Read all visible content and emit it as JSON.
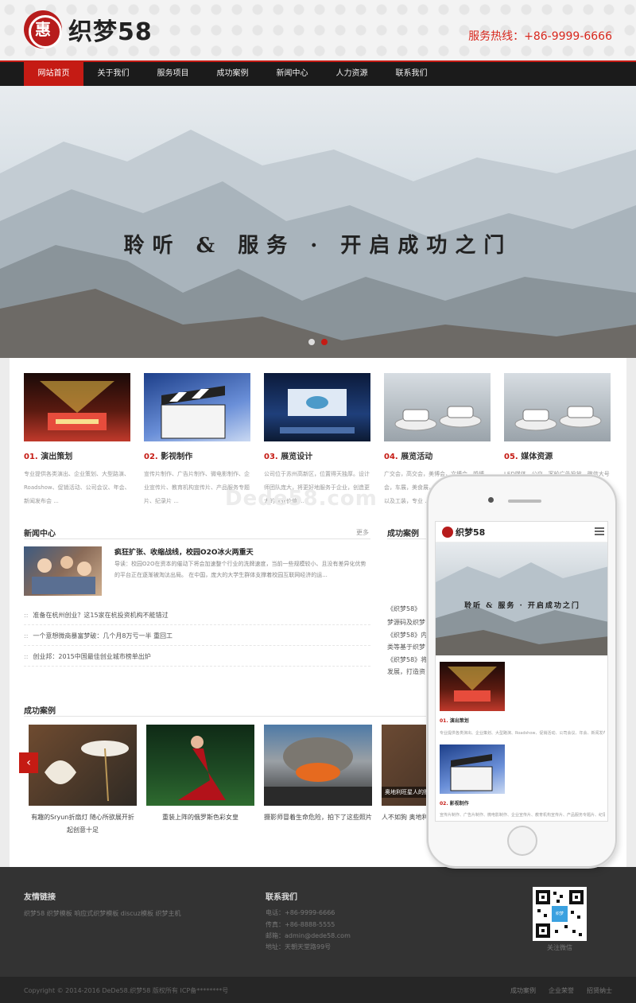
{
  "header": {
    "logo_badge": "惠",
    "logo_text": "织梦58",
    "hotline": "服务热线：+86-9999-6666"
  },
  "nav": {
    "items": [
      "网站首页",
      "关于我们",
      "服务项目",
      "成功案例",
      "新闻中心",
      "人力资源",
      "联系我们"
    ],
    "active": 0
  },
  "banner": {
    "slogan": "聆听 & 服务 · 开启成功之门",
    "slides": 2,
    "active_slide": 1
  },
  "services": [
    {
      "num": "01.",
      "title": "演出策划",
      "desc": "专业提供各类演出、企业策划、大型路演、Roadshow、促销活动、公司会议、年会、新闻发布会 ..."
    },
    {
      "num": "02.",
      "title": "影视制作",
      "desc": "宣传片制作、广告片制作、微电影制作、企业宣传片、教育机构宣传片、产品服务专题片、纪录片 ..."
    },
    {
      "num": "03.",
      "title": "展览设计",
      "desc": "公司位于苏州高新区，位置得天独厚。设计师团队庞大，将更好地服务于企业，创造更大的商业价值 ..."
    },
    {
      "num": "04.",
      "title": "展览活动",
      "desc": "广交会，高交会，美博会，文博会，婚博会，车展，美食展，商务展，展览展示设计以及工装，专业 ..."
    },
    {
      "num": "05.",
      "title": "媒体资源",
      "desc": "LED媒体，公交，客轮广告投放，微信大号 ..."
    }
  ],
  "watermark": "Dede58.com",
  "news": {
    "title": "新闻中心",
    "more": "更多",
    "feature_title": "疯狂扩张、收缩战线，校园O2O冰火两重天",
    "feature_desc": "导读：校园O2O在资本的催动下将会加速整个行业的洗牌速度，当前一些规模较小、且没有差异化优势的平台正在逐渐被淘汰出局。 在中国，庞大的大学生群体支撑着校园互联网经济的运...",
    "items": [
      "准备在杭州创业？这15家在杭投资机构不能错过",
      "一个意想微商暴富梦破：几个月8万亏一半 重回工",
      "创业邦：2015中国最佳创业城市榜单出炉"
    ]
  },
  "case_side": {
    "title": "成功案例",
    "lines": [
      "《织梦58》",
      "梦源码及织梦",
      "《织梦58》内",
      "类等基于织梦",
      "《织梦58》将",
      "发展，打造资"
    ]
  },
  "cases": {
    "title": "成功案例",
    "prev": "‹",
    "items": [
      "有趣的Sryun折扇灯 随心所欲展开折起创意十足",
      "重装上阵的俄罗斯色彩女皇",
      "摄影师冒着生命危险，拍下了这些照片",
      "人不如狗 奥地利旺星人的照片"
    ],
    "overlay_caption": "奥地利旺星人的照"
  },
  "phone": {
    "logo_text": "织梦58",
    "slogan": "聆听 & 服务 · 开启成功之门",
    "items": [
      {
        "num": "01.",
        "title": "演出策划",
        "desc": "专业提供各类演出、企业策划、大型路演、Roadshow、促销活动、公司会议、年会、新闻发布会 ..."
      },
      {
        "num": "02.",
        "title": "影视制作",
        "desc": "宣传片制作、广告片制作、微电影制作、企业宣传片、教育机构宣传片、产品服务专题片、纪录片 ..."
      }
    ]
  },
  "footer": {
    "links_title": "友情链接",
    "links": "织梦58 织梦模板 响应式织梦模板 discuz模板 织梦主机",
    "contact_title": "联系我们",
    "contact": [
      "电话：+86-9999-6666",
      "传真：+86-8888-5555",
      "邮箱：admin@dede58.com",
      "地址：天朝天堂路99号"
    ],
    "qr_label": "关注微信",
    "qr_center": "织梦",
    "copyright": "Copyright © 2014-2016 DeDe58.织梦58 版权所有   ICP备********号",
    "bottom_links": [
      "成功案例",
      "企业荣誉",
      "招贤纳士"
    ]
  },
  "colors": {
    "accent": "#c51b14",
    "nav_bg": "#1b1b1b",
    "footer_bg": "#333333"
  }
}
